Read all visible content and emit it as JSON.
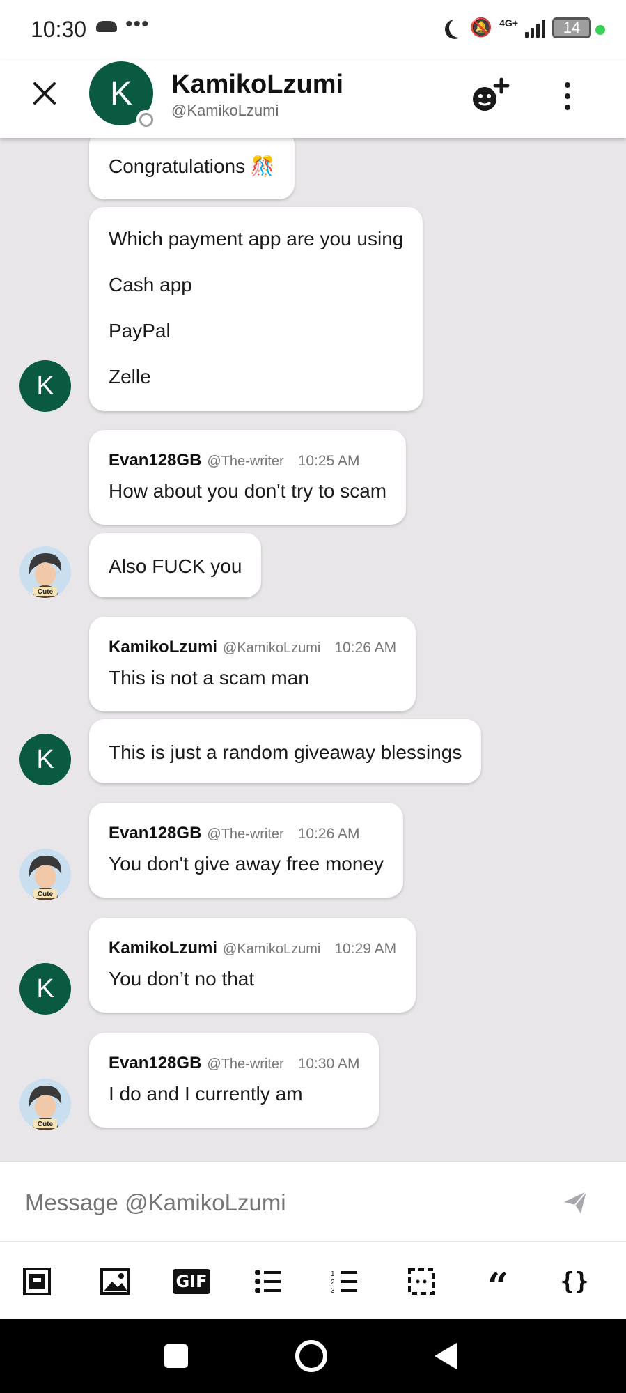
{
  "status_bar": {
    "time": "10:30",
    "dots": "•••",
    "network": "4G+",
    "battery": "14"
  },
  "header": {
    "avatar_letter": "K",
    "name": "KamikoLzumi",
    "handle": "@KamikoLzumi"
  },
  "messages": [
    {
      "text": "Congratulations 🎊"
    },
    {
      "lines": [
        "Which payment app are you using",
        "Cash app",
        "PayPal",
        "Zelle"
      ]
    },
    {
      "author": "Evan128GB",
      "handle": "@The-writer",
      "time": "10:25 AM",
      "text": "How about you don't try to scam"
    },
    {
      "text": "Also FUCK you"
    },
    {
      "author": "KamikoLzumi",
      "handle": "@KamikoLzumi",
      "time": "10:26 AM",
      "text": "This is not a scam man"
    },
    {
      "text": "This is just a random giveaway blessings"
    },
    {
      "author": "Evan128GB",
      "handle": "@The-writer",
      "time": "10:26 AM",
      "text": "You don't give away free money"
    },
    {
      "author": "KamikoLzumi",
      "handle": "@KamikoLzumi",
      "time": "10:29 AM",
      "text": "You don’t no that"
    },
    {
      "author": "Evan128GB",
      "handle": "@The-writer",
      "time": "10:30 AM",
      "text": "I do and I currently am"
    }
  ],
  "avatars": {
    "kamiko_letter": "K",
    "evan_badge": "Cute"
  },
  "composer": {
    "placeholder": "Message @KamikoLzumi"
  },
  "toolbar": {
    "gif_label": "GIF",
    "quote_label": "“",
    "code_label": "{}"
  },
  "colors": {
    "avatar_green": "#0a5a41",
    "background": "#e9e6ea",
    "online_dot": "#3ad15a"
  }
}
